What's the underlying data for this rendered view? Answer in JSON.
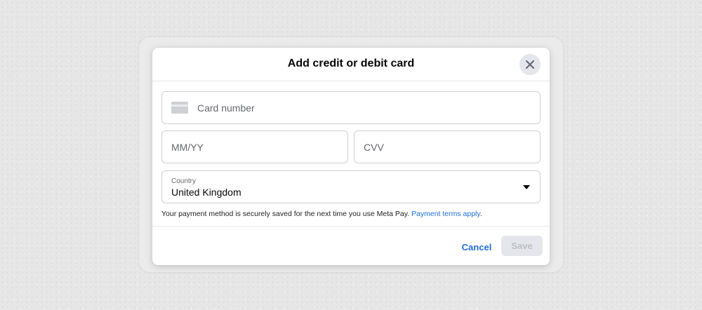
{
  "dialog": {
    "title": "Add credit or debit card",
    "close_icon": "close-icon"
  },
  "form": {
    "card_number": {
      "placeholder": "Card number",
      "icon": "credit-card-icon"
    },
    "expiry": {
      "placeholder": "MM/YY"
    },
    "cvv": {
      "placeholder": "CVV"
    },
    "country": {
      "label": "Country",
      "value": "United Kingdom",
      "icon": "caret-down-icon"
    }
  },
  "notice": {
    "text": "Your payment method is securely saved for the next time you use Meta Pay. ",
    "link": "Payment terms apply",
    "trailing": "."
  },
  "actions": {
    "cancel_label": "Cancel",
    "save_label": "Save"
  },
  "colors": {
    "accent": "#216fdb",
    "disabled_bg": "#e4e6eb",
    "disabled_text": "#bcc0c4",
    "border": "#ced0d4"
  }
}
